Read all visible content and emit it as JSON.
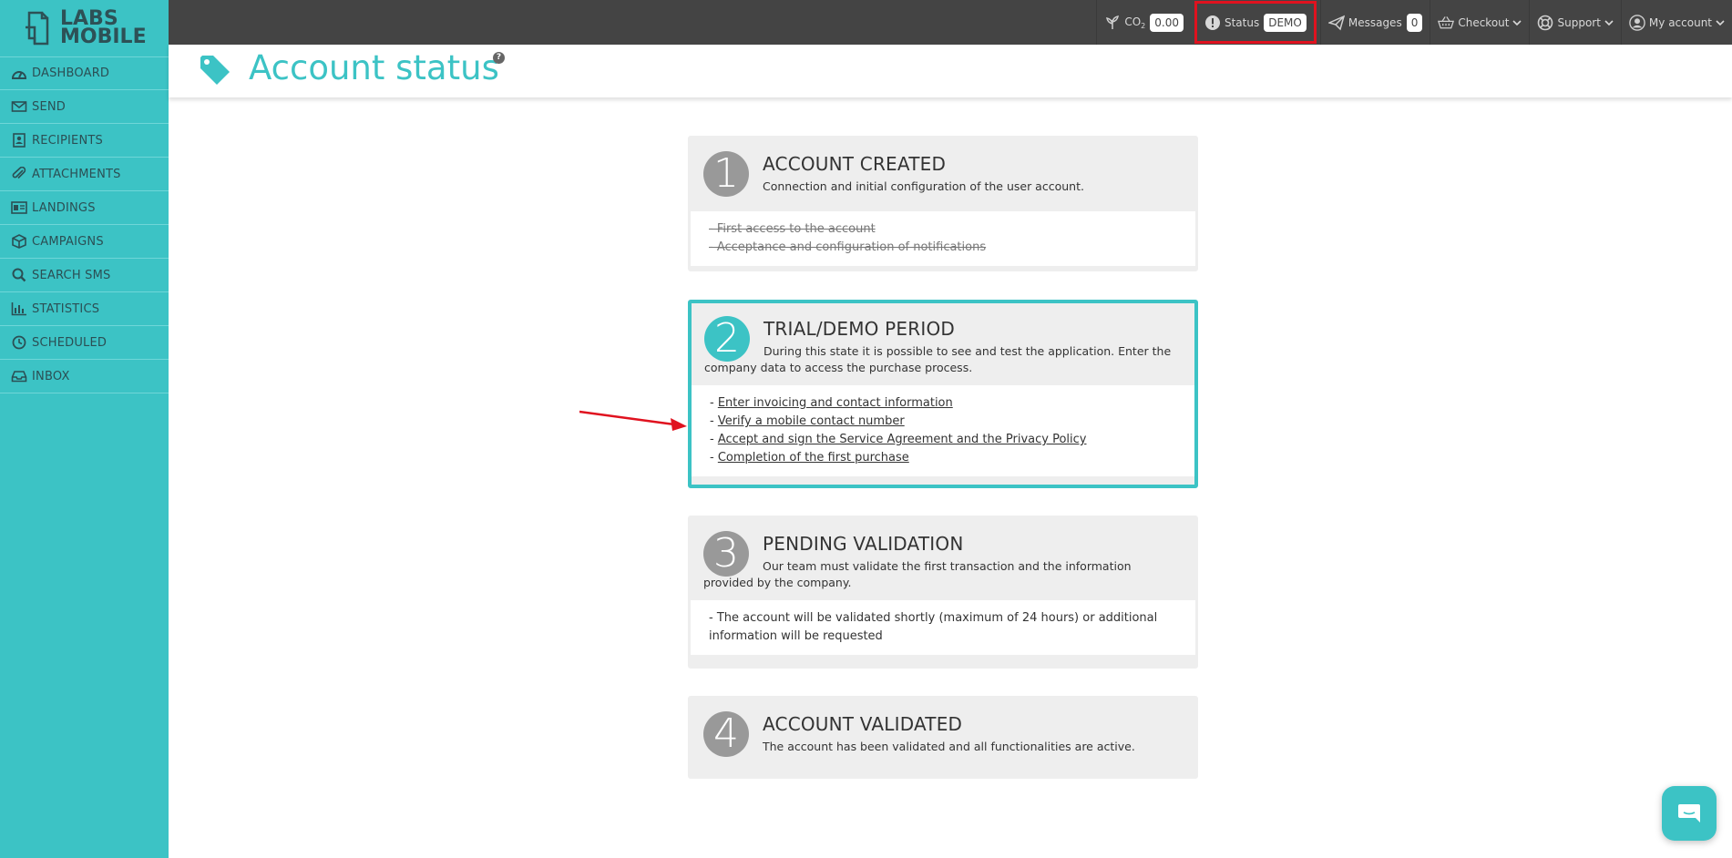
{
  "brand": {
    "logo_line1": "LABS",
    "logo_line2": "MOBILE",
    "accent": "#3cc3c5",
    "topbar_bg": "#444444",
    "highlight": "#e0121f"
  },
  "sidebar": {
    "items": [
      {
        "label": "DASHBOARD",
        "icon": "dashboard-icon"
      },
      {
        "label": "SEND",
        "icon": "envelope-icon"
      },
      {
        "label": "RECIPIENTS",
        "icon": "contacts-icon"
      },
      {
        "label": "ATTACHMENTS",
        "icon": "paperclip-icon"
      },
      {
        "label": "LANDINGS",
        "icon": "landing-icon"
      },
      {
        "label": "CAMPAIGNS",
        "icon": "box-icon"
      },
      {
        "label": "SEARCH SMS",
        "icon": "search-icon"
      },
      {
        "label": "STATISTICS",
        "icon": "chart-icon"
      },
      {
        "label": "SCHEDULED",
        "icon": "clock-icon"
      },
      {
        "label": "INBOX",
        "icon": "inbox-icon"
      }
    ]
  },
  "topbar": {
    "co2_label": "CO",
    "co2_sub": "2",
    "co2_value": "0.00",
    "status_label": "Status",
    "status_value": "DEMO",
    "messages_label": "Messages",
    "messages_count": "0",
    "checkout_label": "Checkout",
    "support_label": "Support",
    "account_label": "My account"
  },
  "page": {
    "title": "Account status",
    "help": "?"
  },
  "steps": [
    {
      "number": "1",
      "title": "ACCOUNT CREATED",
      "description": "Connection and initial configuration of the user account.",
      "items": [
        "- First access to the account",
        "- Acceptance and configuration of notifications"
      ]
    },
    {
      "number": "2",
      "title": "TRIAL/DEMO PERIOD",
      "description": "During this state it is possible to see and test the application. Enter the company data to access the purchase process.",
      "items": [
        "Enter invoicing and contact information",
        "Verify a mobile contact number",
        "Accept and sign the Service Agreement and the Privacy Policy",
        "Completion of the first purchase"
      ],
      "item_prefix": "- "
    },
    {
      "number": "3",
      "title": "PENDING VALIDATION",
      "description": "Our team must validate the first transaction and the information provided by the company.",
      "items": [
        "- The account will be validated shortly (maximum of 24 hours) or additional information will be requested"
      ]
    },
    {
      "number": "4",
      "title": "ACCOUNT VALIDATED",
      "description": "The account has been validated and all functionalities are active."
    }
  ]
}
